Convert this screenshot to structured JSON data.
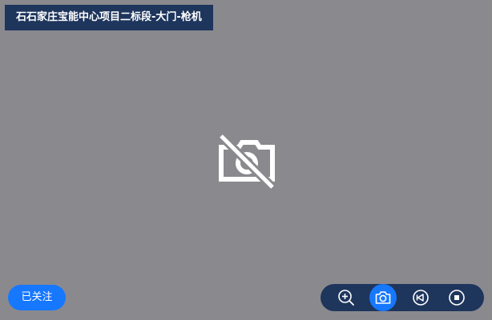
{
  "camera": {
    "title": "石石家庄宝能中心项目二标段-大门-枪机",
    "status_icon": "camera-off-icon"
  },
  "follow_button": {
    "label": "已关注",
    "color": "#1677ff"
  },
  "toolbar": {
    "background": "#1e355c",
    "items": [
      {
        "name": "zoom-in",
        "icon": "zoom-in-icon",
        "active": false
      },
      {
        "name": "snapshot",
        "icon": "camera-icon",
        "active": true
      },
      {
        "name": "playback",
        "icon": "rewind-icon",
        "active": false
      },
      {
        "name": "stop",
        "icon": "stop-icon",
        "active": false
      }
    ]
  },
  "colors": {
    "video_background": "#8a898e",
    "title_background": "#1e355c",
    "accent": "#1677ff"
  }
}
